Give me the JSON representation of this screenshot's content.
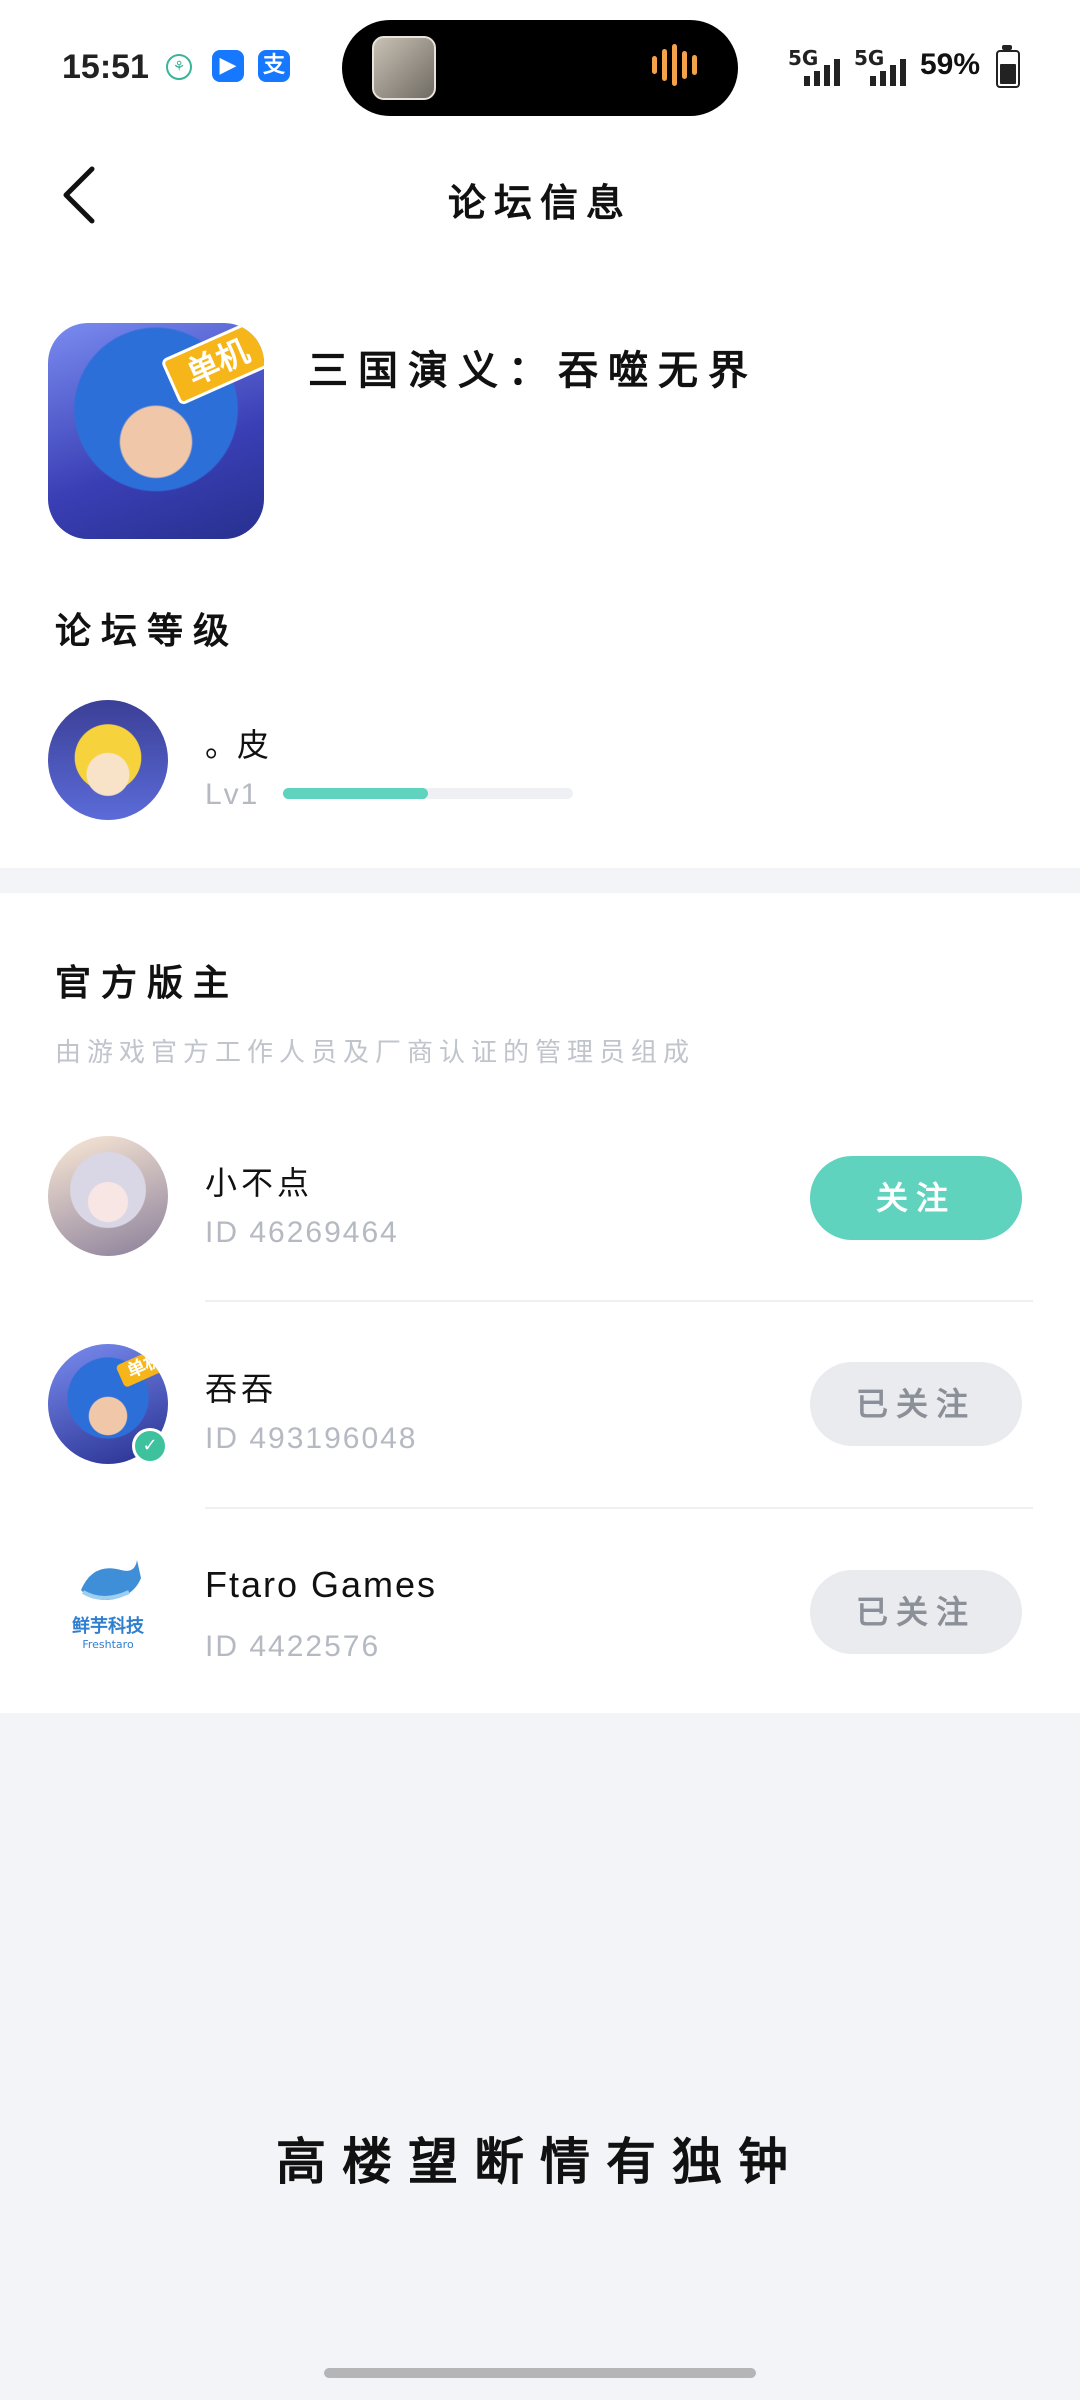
{
  "status_bar": {
    "time": "15:51",
    "network_1": "5G",
    "network_2": "5G",
    "battery": "59%"
  },
  "header": {
    "title": "论坛信息"
  },
  "game": {
    "name": "三国演义：吞噬无界",
    "badge": "单机"
  },
  "forum_level": {
    "section_title": "论坛等级",
    "user": {
      "name": "。皮",
      "level": "Lv1",
      "progress": 0.5
    }
  },
  "moderators": {
    "section_title": "官方版主",
    "subtitle": "由游戏官方工作人员及厂商认证的管理员组成",
    "items": [
      {
        "name": "小不点",
        "id": "ID 46269464",
        "button": "关注"
      },
      {
        "name": "吞吞",
        "id": "ID 493196048",
        "button": "已关注",
        "avatar_badge": "单机"
      },
      {
        "name": "Ftaro Games",
        "id": "ID 4422576",
        "button": "已关注",
        "avatar_caption": "鲜芋科技",
        "avatar_caption_en": "Freshtaro"
      }
    ]
  },
  "footer": {
    "text": "高楼望断情有独钟"
  },
  "colors": {
    "accent": "#5fd3be",
    "divider": "#eef0f3",
    "muted_text": "#b5b9c2"
  }
}
